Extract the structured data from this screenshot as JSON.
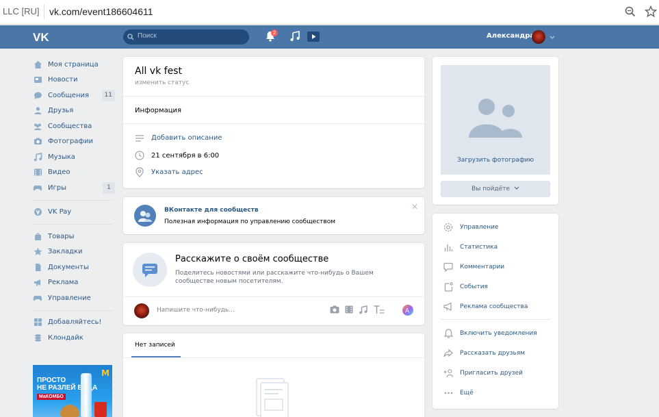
{
  "browser": {
    "cert_label": "LLC [RU]",
    "url": "vk.com/event186604611"
  },
  "header": {
    "search_placeholder": "Поиск",
    "notif_count": "2",
    "user_name": "Александра"
  },
  "sidebar": {
    "items": [
      {
        "label": "Моя страница",
        "icon": "home-icon"
      },
      {
        "label": "Новости",
        "icon": "news-icon"
      },
      {
        "label": "Сообщения",
        "icon": "messages-icon",
        "count": "11"
      },
      {
        "label": "Друзья",
        "icon": "friend-icon"
      },
      {
        "label": "Сообщества",
        "icon": "groups-icon"
      },
      {
        "label": "Фотографии",
        "icon": "camera-icon"
      },
      {
        "label": "Музыка",
        "icon": "music-icon"
      },
      {
        "label": "Видео",
        "icon": "video-icon"
      },
      {
        "label": "Игры",
        "icon": "gamepad-icon",
        "count": "1"
      }
    ],
    "pay": {
      "label": "VK Pay",
      "icon": "vkpay-icon"
    },
    "more": [
      {
        "label": "Товары",
        "icon": "bag-icon"
      },
      {
        "label": "Закладки",
        "icon": "star-icon"
      },
      {
        "label": "Документы",
        "icon": "document-icon"
      },
      {
        "label": "Реклама",
        "icon": "megaphone-icon"
      },
      {
        "label": "Управление",
        "icon": "gamepad-icon"
      }
    ],
    "extra": [
      {
        "label": "Добавляйтесь!",
        "icon": "apps-icon"
      },
      {
        "label": "Клондайк",
        "icon": "coins-icon"
      }
    ],
    "promo": {
      "line1": "ПРОСТО",
      "line2": "НЕ РАЗЛЕЙ ВОДА",
      "sub": "МаКОМБО"
    }
  },
  "group": {
    "title": "All vk fest",
    "status_placeholder": "изменить статус",
    "info_heading": "Информация",
    "add_description": "Добавить описание",
    "date": "21 сентября в 6:00",
    "address": "Указать адрес"
  },
  "tip": {
    "title": "ВКонтакте для сообществ",
    "text": "Полезная информация по управлению сообществом"
  },
  "tell": {
    "title": "Расскажите о своём сообществе",
    "text": "Поделитесь новостями или расскажите что-нибудь о Вашем сообществе новым посетителям.",
    "composer_placeholder": "Напишите что-нибудь..."
  },
  "wall": {
    "tab_label": "Нет записей"
  },
  "right": {
    "upload_label": "Загрузить фотографию",
    "going_button": "Вы пойдёте",
    "actions": [
      {
        "label": "Управление",
        "icon": "gear-icon"
      },
      {
        "label": "Статистика",
        "icon": "stats-icon"
      },
      {
        "label": "Комментарии",
        "icon": "comment-icon"
      },
      {
        "label": "События",
        "icon": "calendar-icon"
      },
      {
        "label": "Реклама сообщества",
        "icon": "megaphone-icon"
      }
    ],
    "actions2": [
      {
        "label": "Включить уведомления",
        "icon": "bell-icon"
      },
      {
        "label": "Рассказать друзьям",
        "icon": "share-icon"
      },
      {
        "label": "Пригласить друзей",
        "icon": "invite-icon"
      },
      {
        "label": "Ещё",
        "icon": "more-icon"
      }
    ]
  },
  "colors": {
    "vk_blue": "#4a76a8",
    "link": "#2a5885",
    "background": "#edeef0"
  }
}
